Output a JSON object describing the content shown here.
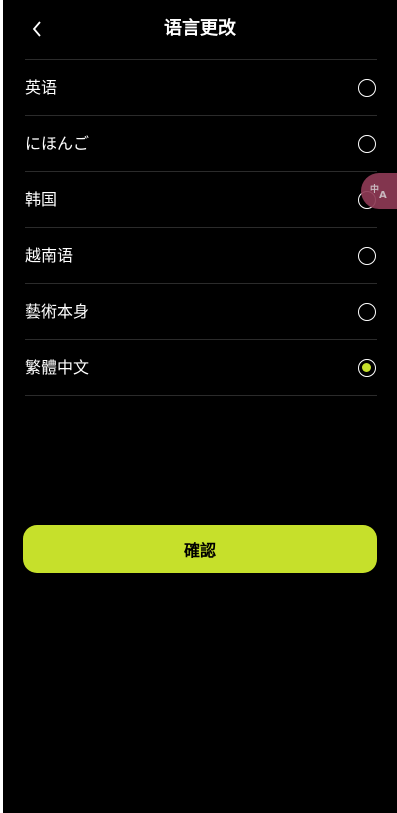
{
  "header": {
    "title": "语言更改",
    "back_icon": "chevron-left-icon"
  },
  "languages": [
    {
      "label": "英语",
      "selected": false
    },
    {
      "label": "にほんご",
      "selected": false
    },
    {
      "label": "韩国",
      "selected": false
    },
    {
      "label": "越南语",
      "selected": false
    },
    {
      "label": "藝術本身",
      "selected": false
    },
    {
      "label": "繁體中文",
      "selected": true
    }
  ],
  "confirm_label": "確認",
  "translate_fab": {
    "icon": "translate-icon",
    "text": "中A"
  },
  "colors": {
    "accent": "#c6e02b",
    "background": "#000000",
    "fab": "#8e3a55"
  }
}
